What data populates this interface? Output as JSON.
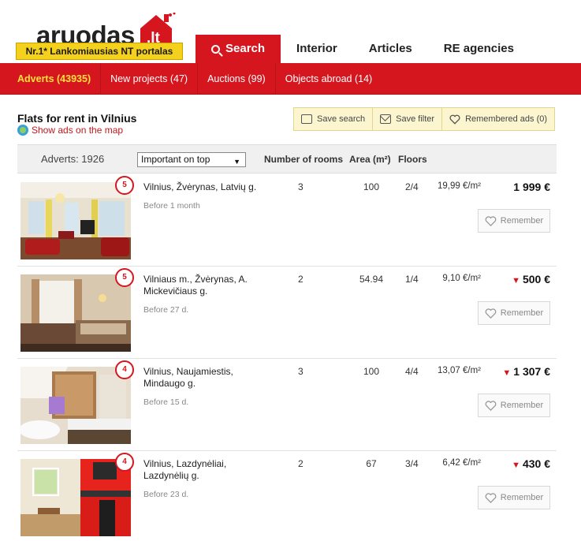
{
  "logo": {
    "text": "aruodas",
    "tld": ".lt",
    "tagline": "Nr.1* Lankomiausias NT portalas"
  },
  "nav": {
    "items": [
      {
        "label": "Search",
        "active": true
      },
      {
        "label": "Interior"
      },
      {
        "label": "Articles"
      },
      {
        "label": "RE agencies"
      }
    ]
  },
  "subnav": {
    "items": [
      {
        "label": "Adverts (43935)",
        "active": true
      },
      {
        "label": "New projects (47)"
      },
      {
        "label": "Auctions (99)"
      },
      {
        "label": "Objects abroad (14)"
      }
    ]
  },
  "page": {
    "title": "Flats for rent in Vilnius",
    "map_link": "Show ads on the map"
  },
  "tools": {
    "save_search": "Save search",
    "save_filter": "Save filter",
    "remembered": "Remembered ads (0)"
  },
  "list_header": {
    "adverts": "Adverts: 1926",
    "sort_selected": "Important on top",
    "col_rooms": "Number of rooms",
    "col_area": "Area (m²)",
    "col_floors": "Floors"
  },
  "listings": [
    {
      "badge": "5",
      "address": "Vilnius, Žvėrynas, Latvių g.",
      "age": "Before 1 month",
      "rooms": "3",
      "area": "100",
      "floor": "2/4",
      "price_per_m2": "19,99 €/m²",
      "price": "1 999 €",
      "price_down": false,
      "remember": "Remember"
    },
    {
      "badge": "5",
      "address": "Vilniaus m., Žvėrynas, A. Mickevičiaus g.",
      "age": "Before 27 d.",
      "rooms": "2",
      "area": "54.94",
      "floor": "1/4",
      "price_per_m2": "9,10 €/m²",
      "price": "500 €",
      "price_down": true,
      "remember": "Remember"
    },
    {
      "badge": "4",
      "address": "Vilnius, Naujamiestis, Mindaugo g.",
      "age": "Before 15 d.",
      "rooms": "3",
      "area": "100",
      "floor": "4/4",
      "price_per_m2": "13,07 €/m²",
      "price": "1 307 €",
      "price_down": true,
      "remember": "Remember"
    },
    {
      "badge": "4",
      "address": "Vilnius, Lazdynėliai, Lazdynėlių g.",
      "age": "Before 23 d.",
      "rooms": "2",
      "area": "67",
      "floor": "3/4",
      "price_per_m2": "6,42 €/m²",
      "price": "430 €",
      "price_down": true,
      "remember": "Remember"
    }
  ],
  "colors": {
    "brand_red": "#d6161f",
    "banner_yellow": "#f4d11c",
    "active_sub": "#ffe13a"
  }
}
